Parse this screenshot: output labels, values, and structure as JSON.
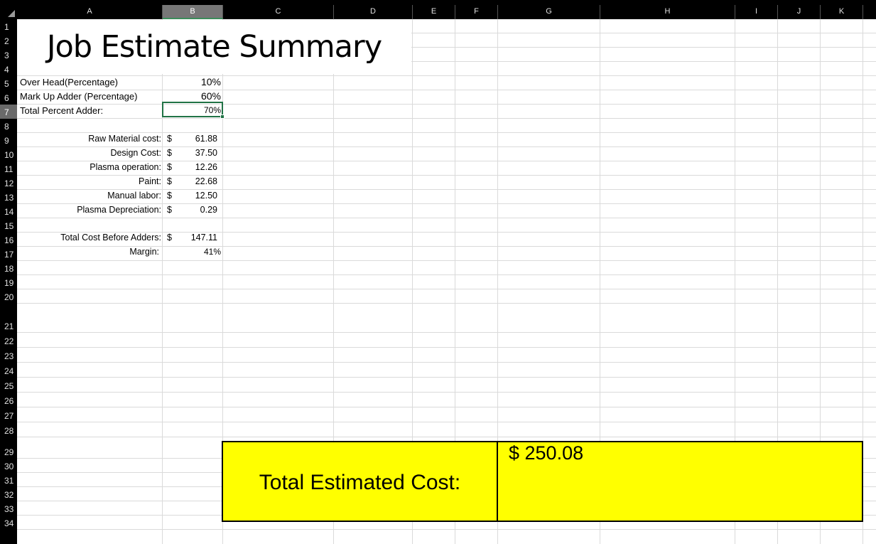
{
  "columns": [
    "A",
    "B",
    "C",
    "D",
    "E",
    "F",
    "G",
    "H",
    "I",
    "J",
    "K"
  ],
  "selected_column": "B",
  "rows": [
    "1",
    "2",
    "3",
    "4",
    "5",
    "6",
    "7",
    "8",
    "9",
    "10",
    "11",
    "12",
    "13",
    "14",
    "15",
    "16",
    "17",
    "18",
    "19",
    "20",
    "21",
    "22",
    "23",
    "24",
    "25",
    "26",
    "27",
    "28",
    "29",
    "30",
    "31",
    "32",
    "33",
    "34"
  ],
  "selected_row": "7",
  "title": "Job Estimate Summary",
  "adders": [
    {
      "label": "Over Head(Percentage)",
      "value": "10%"
    },
    {
      "label": "Mark Up Adder (Percentage)",
      "value": "60%"
    },
    {
      "label": "Total Percent Adder:",
      "value": "70%"
    }
  ],
  "costs": [
    {
      "label": "Raw Material cost:",
      "currency": "$",
      "value": "61.88"
    },
    {
      "label": "Design Cost:",
      "currency": "$",
      "value": "37.50"
    },
    {
      "label": "Plasma operation:",
      "currency": "$",
      "value": "12.26"
    },
    {
      "label": "Paint:",
      "currency": "$",
      "value": "22.68"
    },
    {
      "label": "Manual labor:",
      "currency": "$",
      "value": "12.50"
    },
    {
      "label": "Plasma Depreciation:",
      "currency": "$",
      "value": "0.29"
    }
  ],
  "total_before": {
    "label": "Total Cost Before Adders:",
    "currency": "$",
    "value": "147.11"
  },
  "margin": {
    "label": "Margin:",
    "value": "41%"
  },
  "total_estimated": {
    "label": "Total Estimated Cost:",
    "value": "$ 250.08"
  },
  "colors": {
    "highlight": "#ffff00",
    "selection": "#217346",
    "header_bg": "#000000"
  }
}
